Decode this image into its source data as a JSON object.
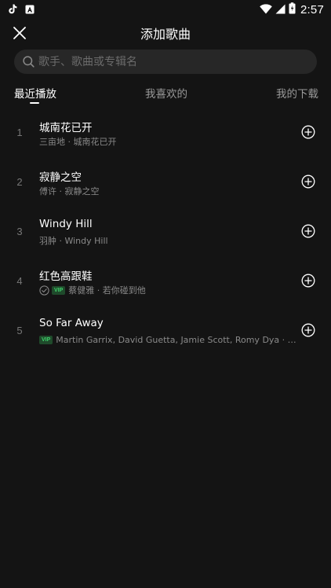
{
  "status_bar": {
    "time": "2:57",
    "icons": [
      "tiktok-icon",
      "app-icon",
      "wifi-icon",
      "signal-icon",
      "battery-icon"
    ]
  },
  "header": {
    "title": "添加歌曲",
    "close_icon": "close-icon"
  },
  "search": {
    "placeholder": "歌手、歌曲或专辑名",
    "value": ""
  },
  "tabs": [
    {
      "label": "最近播放",
      "active": true
    },
    {
      "label": "我喜欢的",
      "active": false
    },
    {
      "label": "我的下载",
      "active": false
    }
  ],
  "songs": [
    {
      "index": "1",
      "title": "城南花已开",
      "meta": "三亩地 · 城南花已开",
      "vip": false,
      "downloaded": false
    },
    {
      "index": "2",
      "title": "寂静之空",
      "meta": "傅许 · 寂静之空",
      "vip": false,
      "downloaded": false
    },
    {
      "index": "3",
      "title": "Windy Hill",
      "meta": "羽肿 · Windy Hill",
      "vip": false,
      "downloaded": false
    },
    {
      "index": "4",
      "title": "红色高跟鞋",
      "meta": "蔡健雅 · 若你碰到他",
      "vip": true,
      "downloaded": true
    },
    {
      "index": "5",
      "title": "So Far Away",
      "meta": "Martin Garrix, David Guetta, Jamie Scott, Romy Dya · So F...",
      "vip": true,
      "downloaded": false
    }
  ],
  "labels": {
    "vip": "VIP"
  },
  "colors": {
    "background": "#141414",
    "search_bg": "#272727",
    "vip_green": "#3fd06a",
    "secondary_text": "#8a8a8a"
  }
}
